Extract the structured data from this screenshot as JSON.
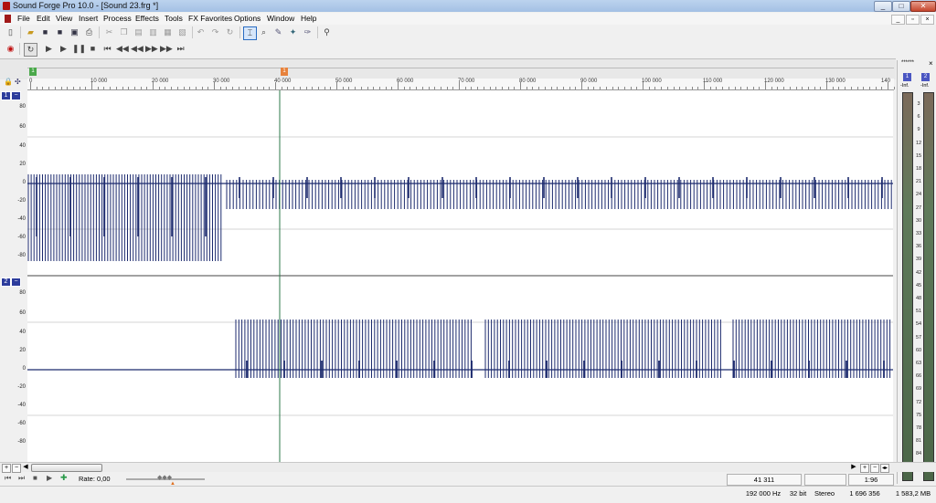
{
  "window": {
    "title": "Sound Forge Pro 10.0 - [Sound 23.frg *]",
    "controls": [
      "_",
      "□",
      "✕"
    ]
  },
  "menu": [
    "File",
    "Edit",
    "View",
    "Insert",
    "Process",
    "Effects",
    "Tools",
    "FX Favorites",
    "Options",
    "Window",
    "Help"
  ],
  "mdi_controls": [
    "_",
    "▫",
    "×"
  ],
  "ruler": {
    "labels": [
      "0",
      "10 000",
      "20 000",
      "30 000",
      "40 000",
      "50 000",
      "60 000",
      "70 000",
      "80 000",
      "90 000",
      "100 000",
      "110 000",
      "120 000",
      "130 000",
      "140"
    ],
    "markers": [
      "1",
      "1"
    ]
  },
  "channels": [
    {
      "badge": "1",
      "scale": [
        "80",
        "60",
        "40",
        "20",
        "0",
        "-20",
        "-40",
        "-60",
        "-80"
      ]
    },
    {
      "badge": "2",
      "scale": [
        "80",
        "60",
        "40",
        "20",
        "0",
        "-20",
        "-40",
        "-60",
        "-80"
      ]
    }
  ],
  "meters": {
    "panel_label": "******",
    "channels": [
      "1",
      "2"
    ],
    "top_label": "-Inf.",
    "scale": [
      "3",
      "6",
      "9",
      "12",
      "15",
      "18",
      "21",
      "24",
      "27",
      "30",
      "33",
      "36",
      "39",
      "42",
      "45",
      "48",
      "51",
      "54",
      "57",
      "60",
      "63",
      "66",
      "69",
      "72",
      "75",
      "78",
      "81",
      "84",
      "87"
    ]
  },
  "transport": {
    "rate_label": "Rate: 0,00",
    "position": "41 311",
    "zoom": "1:96"
  },
  "status": {
    "sample_rate": "192 000 Hz",
    "bit_depth": "32 bit",
    "channels": "Stereo",
    "length": "1 696 356",
    "disk": "1 583,2 MB"
  },
  "colors": {
    "waveform": "#1c2a6e",
    "cursor": "#2c7a4a",
    "channel_badge": "#2c3c9c",
    "title_bar": "#bcd3ee"
  }
}
